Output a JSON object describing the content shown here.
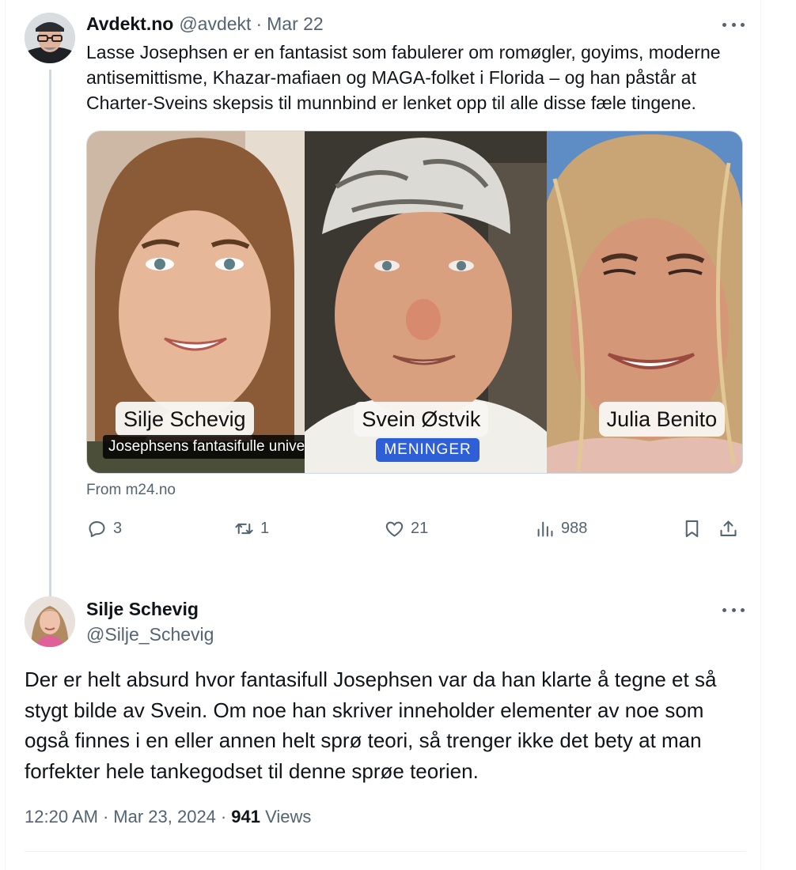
{
  "parent_tweet": {
    "author_name": "Avdekt.no",
    "author_handle": "@avdekt",
    "separator": "·",
    "date": "Mar 22",
    "text": "Lasse Josephsen er en fantasist som fabulerer om romøgler, goyims, moderne antisemittisme, Khazar-mafiaen og MAGA-folket i Florida – og han påstår at Charter-Sveins skepsis til munnbind er lenket opp til alle disse fæle tingene.",
    "media": {
      "names": [
        "Silje Schevig",
        "Svein Østvik",
        "Julia Benito"
      ],
      "caption": "Josephsens fantasifulle univers",
      "badge": "MENINGER"
    },
    "source": "From m24.no",
    "stats": {
      "replies": "3",
      "retweets": "1",
      "likes": "21",
      "views": "988"
    }
  },
  "reply_tweet": {
    "author_name": "Silje Schevig",
    "author_handle": "@Silje_Schevig",
    "text": "Der er helt absurd hvor fantasifull Josephsen var da han klarte å tegne et så stygt bilde av Svein. Om noe han skriver inneholder elementer av noe som også finnes i en eller annen helt sprø teori, så trenger ikke det bety at man forfekter hele tankegodset til denne sprøe teorien.",
    "time": "12:20 AM",
    "separator": "·",
    "date": "Mar 23, 2024",
    "views_count": "941",
    "views_label": "Views"
  },
  "icons": {
    "reply": "speech-bubble-icon",
    "retweet": "retweet-arrows-icon",
    "like": "heart-icon",
    "views": "bar-chart-icon",
    "bookmark": "bookmark-icon",
    "share": "share-upload-icon",
    "more": "three-dots-icon"
  },
  "colors": {
    "text_primary": "#0f1419",
    "text_secondary": "#536471",
    "thread_line": "#cfd9de",
    "badge_blue": "#2f5fd6"
  }
}
